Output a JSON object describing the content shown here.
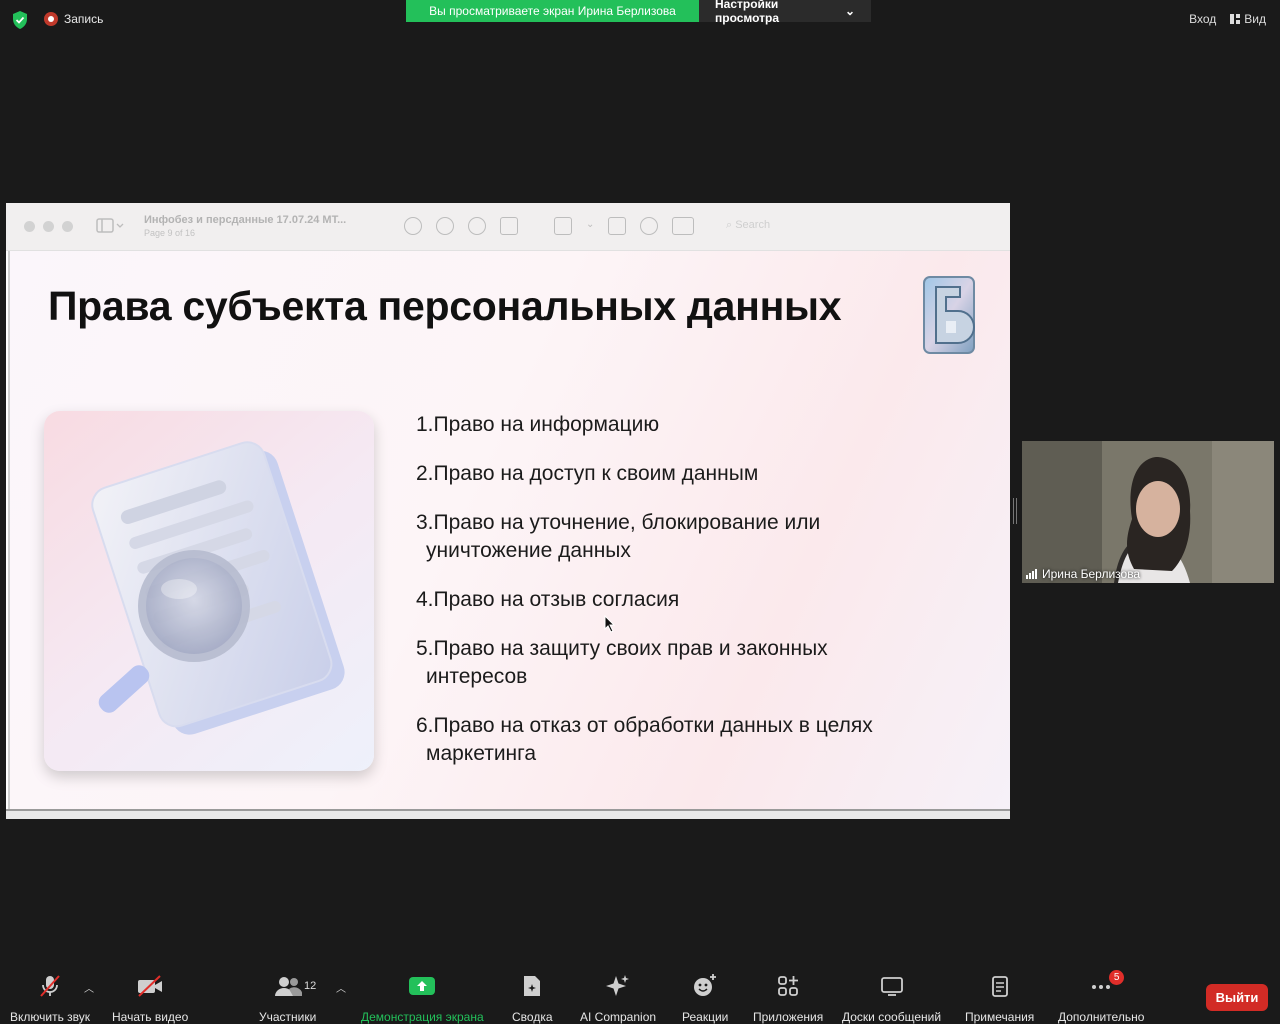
{
  "topbar": {
    "recording_label": "Запись",
    "viewing_text": "Вы просматриваете экран Ирина Берлизова",
    "view_settings_label": "Настройки просмотра",
    "signin_label": "Вход",
    "view_label": "Вид"
  },
  "preview": {
    "doc_title": "Инфобез и персданные 17.07.24 МТ...",
    "page_info": "Page 9 of 16",
    "search_placeholder": "Search"
  },
  "slide": {
    "title": "Права субъекта персональных данных",
    "rights": [
      {
        "line1": "1.Право на информацию",
        "line2": ""
      },
      {
        "line1": "2.Право на доступ к своим данным",
        "line2": ""
      },
      {
        "line1": "3.Право на уточнение, блокирование или",
        "line2": "уничтожение данных"
      },
      {
        "line1": "4.Право на отзыв согласия",
        "line2": ""
      },
      {
        "line1": "5.Право на защиту своих прав и законных",
        "line2": "интересов"
      },
      {
        "line1": "6.Право на отказ от обработки данных в целях",
        "line2": "маркетинга"
      }
    ]
  },
  "participant": {
    "name": "Ирина Берлизова"
  },
  "toolbar": {
    "unmute_label": "Включить звук",
    "video_label": "Начать видео",
    "participants_label": "Участники",
    "participants_count": "12",
    "share_label": "Демонстрация экрана",
    "summary_label": "Сводка",
    "ai_label": "AI Companion",
    "reactions_label": "Реакции",
    "apps_label": "Приложения",
    "whiteboards_label": "Доски сообщений",
    "notes_label": "Примечания",
    "more_label": "Дополнительно",
    "more_badge": "5",
    "leave_label": "Выйти"
  },
  "colors": {
    "share_green": "#23c05a",
    "leave_red": "#d22b25",
    "background": "#1a1a1a"
  }
}
